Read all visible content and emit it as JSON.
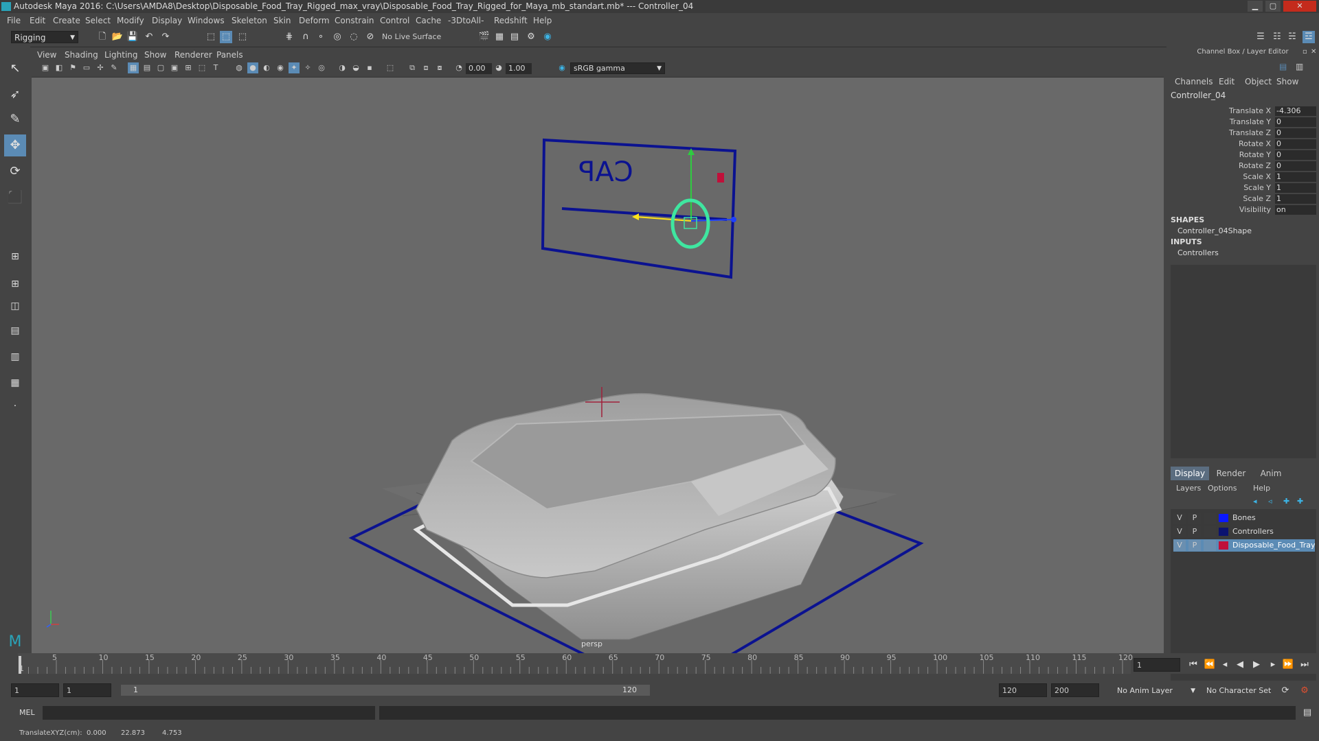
{
  "window": {
    "title": "Autodesk Maya 2016: C:\\Users\\AMDA8\\Desktop\\Disposable_Food_Tray_Rigged_max_vray\\Disposable_Food_Tray_Rigged_for_Maya_mb_standart.mb*   ---   Controller_04"
  },
  "menu": [
    "File",
    "Edit",
    "Create",
    "Select",
    "Modify",
    "Display",
    "Windows",
    "Skeleton",
    "Skin",
    "Deform",
    "Constrain",
    "Control",
    "Cache",
    "-3DtoAll-",
    "Redshift",
    "Help"
  ],
  "statusline": {
    "menu_set": "Rigging",
    "live_surface": "No Live Surface"
  },
  "viewport": {
    "menu": [
      "View",
      "Shading",
      "Lighting",
      "Show",
      "Renderer",
      "Panels"
    ],
    "near_value": "0.00",
    "far_value": "1.00",
    "color_space": "sRGB gamma",
    "camera_label": "persp",
    "controller_text": "CAP"
  },
  "channel_box": {
    "header": "Channel Box / Layer Editor",
    "tabs": [
      "Channels",
      "Edit",
      "Object",
      "Show"
    ],
    "object_name": "Controller_04",
    "attributes": [
      {
        "label": "Translate X",
        "value": "-4.306"
      },
      {
        "label": "Translate Y",
        "value": "0"
      },
      {
        "label": "Translate Z",
        "value": "0"
      },
      {
        "label": "Rotate X",
        "value": "0"
      },
      {
        "label": "Rotate Y",
        "value": "0"
      },
      {
        "label": "Rotate Z",
        "value": "0"
      },
      {
        "label": "Scale X",
        "value": "1"
      },
      {
        "label": "Scale Y",
        "value": "1"
      },
      {
        "label": "Scale Z",
        "value": "1"
      },
      {
        "label": "Visibility",
        "value": "on"
      }
    ],
    "shapes_title": "SHAPES",
    "shape_name": "Controller_04Shape",
    "inputs_title": "INPUTS",
    "input_name": "Controllers"
  },
  "layer_editor": {
    "tabs": [
      "Display",
      "Render",
      "Anim"
    ],
    "menu": [
      "Layers",
      "Options",
      "Help"
    ],
    "layers": [
      {
        "v": "V",
        "p": "P",
        "color": "#0a18ff",
        "name": "Bones"
      },
      {
        "v": "V",
        "p": "P",
        "color": "#0b1270",
        "name": "Controllers"
      },
      {
        "v": "V",
        "p": "P",
        "color": "#c0103a",
        "name": "Disposable_Food_Tray"
      }
    ]
  },
  "timeline": {
    "ticks": [
      "1",
      "5",
      "10",
      "15",
      "20",
      "25",
      "30",
      "35",
      "40",
      "45",
      "50",
      "55",
      "60",
      "65",
      "70",
      "75",
      "80",
      "85",
      "90",
      "95",
      "100",
      "105",
      "110",
      "115",
      "120"
    ],
    "current_frame": "1"
  },
  "range": {
    "start": "1",
    "playback_start": "1",
    "slider_start": "1",
    "slider_end": "120",
    "playback_end": "120",
    "end": "200",
    "anim_layer": "No Anim Layer",
    "character_set": "No Character Set"
  },
  "cmdline": {
    "lang": "MEL"
  },
  "helpline": {
    "label": "TranslateXYZ(cm):",
    "x": "0.000",
    "y": "22.873",
    "z": "4.753"
  }
}
